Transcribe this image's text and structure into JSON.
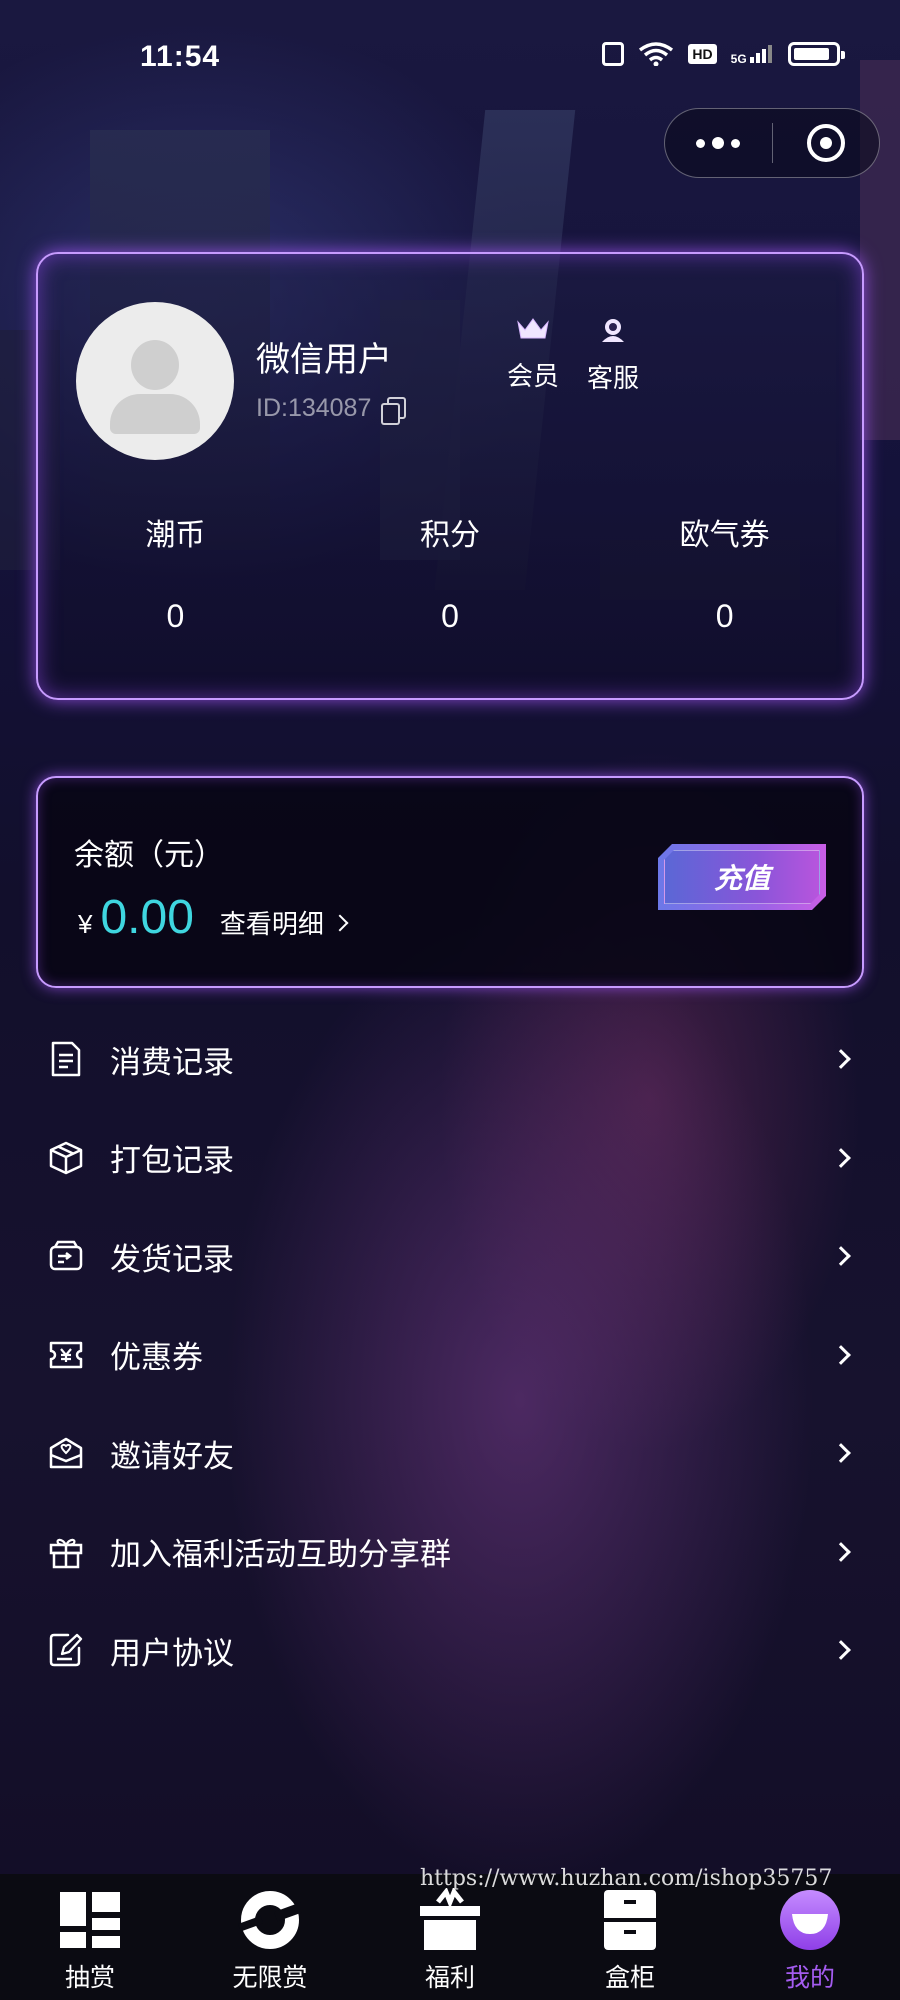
{
  "status_bar": {
    "time": "11:54",
    "network": "5G",
    "hd_badge": "HD"
  },
  "profile": {
    "nickname": "微信用户",
    "user_id": "ID:134087",
    "member_label": "会员",
    "service_label": "客服",
    "stats": [
      {
        "label": "潮币",
        "value": "0"
      },
      {
        "label": "积分",
        "value": "0"
      },
      {
        "label": "欧气券",
        "value": "0"
      }
    ]
  },
  "balance": {
    "title": "余额（元）",
    "currency": "¥",
    "amount": "0.00",
    "detail_link": "查看明细",
    "recharge_button": "充值"
  },
  "menu": [
    {
      "label": "消费记录",
      "icon": "document-icon"
    },
    {
      "label": "打包记录",
      "icon": "box-icon"
    },
    {
      "label": "发货记录",
      "icon": "delivery-icon"
    },
    {
      "label": "优惠券",
      "icon": "coupon-icon"
    },
    {
      "label": "邀请好友",
      "icon": "invite-icon"
    },
    {
      "label": "加入福利活动互助分享群",
      "icon": "gift-icon"
    },
    {
      "label": "用户协议",
      "icon": "agreement-icon"
    }
  ],
  "watermark": "https://www.huzhan.com/ishop35757",
  "tabbar": [
    {
      "label": "抽赏",
      "icon": "grid-icon",
      "active": false
    },
    {
      "label": "无限赏",
      "icon": "cycle-icon",
      "active": false
    },
    {
      "label": "福利",
      "icon": "gift-box-icon",
      "active": false
    },
    {
      "label": "盒柜",
      "icon": "cabinet-icon",
      "active": false
    },
    {
      "label": "我的",
      "icon": "smile-icon",
      "active": true
    }
  ],
  "colors": {
    "accent": "#a45cf0",
    "balance_amount": "#3fd6e0",
    "card_border": "#c79bff"
  }
}
